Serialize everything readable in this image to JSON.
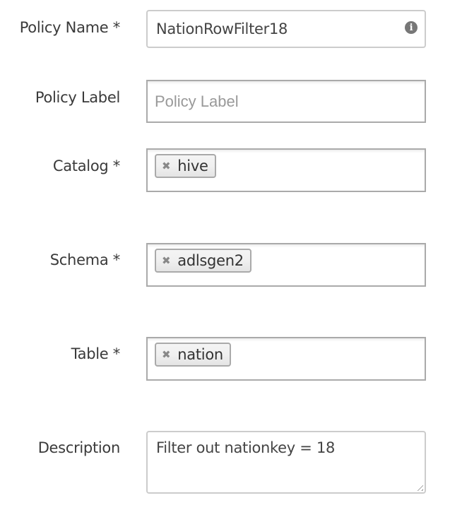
{
  "form": {
    "policy_name": {
      "label": "Policy Name *",
      "value": "NationRowFilter18",
      "icon": "info-icon"
    },
    "policy_label": {
      "label": "Policy Label",
      "value": "",
      "placeholder": "Policy Label"
    },
    "catalog": {
      "label": "Catalog *",
      "tags": [
        "hive"
      ]
    },
    "schema": {
      "label": "Schema *",
      "tags": [
        "adlsgen2"
      ]
    },
    "table": {
      "label": "Table *",
      "tags": [
        "nation"
      ]
    },
    "description": {
      "label": "Description",
      "value": "Filter out nationkey = 18"
    },
    "tag_remove_glyph": "✖"
  }
}
